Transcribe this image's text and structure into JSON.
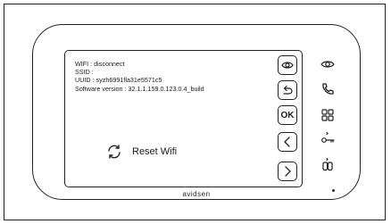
{
  "info": {
    "wifi": "WIFI : disconnect",
    "ssid": "SSID :",
    "uuid": "UUID : syzh6991fla31e5571c5",
    "software": "Software version : 32.1.1.159.0.123.0.4_build"
  },
  "reset": {
    "label": "Reset Wifi",
    "icon": "refresh-icon"
  },
  "side_buttons": [
    {
      "name": "eye-button",
      "icon": "eye-icon"
    },
    {
      "name": "back-button",
      "icon": "back-arrow-icon"
    },
    {
      "name": "ok-button",
      "label": "OK"
    },
    {
      "name": "left-button",
      "icon": "chevron-left-icon"
    },
    {
      "name": "right-button",
      "icon": "chevron-right-icon"
    }
  ],
  "device_buttons": [
    {
      "name": "camera-view",
      "icon": "eye-icon"
    },
    {
      "name": "call",
      "icon": "phone-icon"
    },
    {
      "name": "menu",
      "icon": "grid-icon"
    },
    {
      "name": "unlock-door",
      "icon": "key-icon"
    },
    {
      "name": "unlock-gate",
      "icon": "gate-icon"
    }
  ],
  "brand": "avidsen"
}
